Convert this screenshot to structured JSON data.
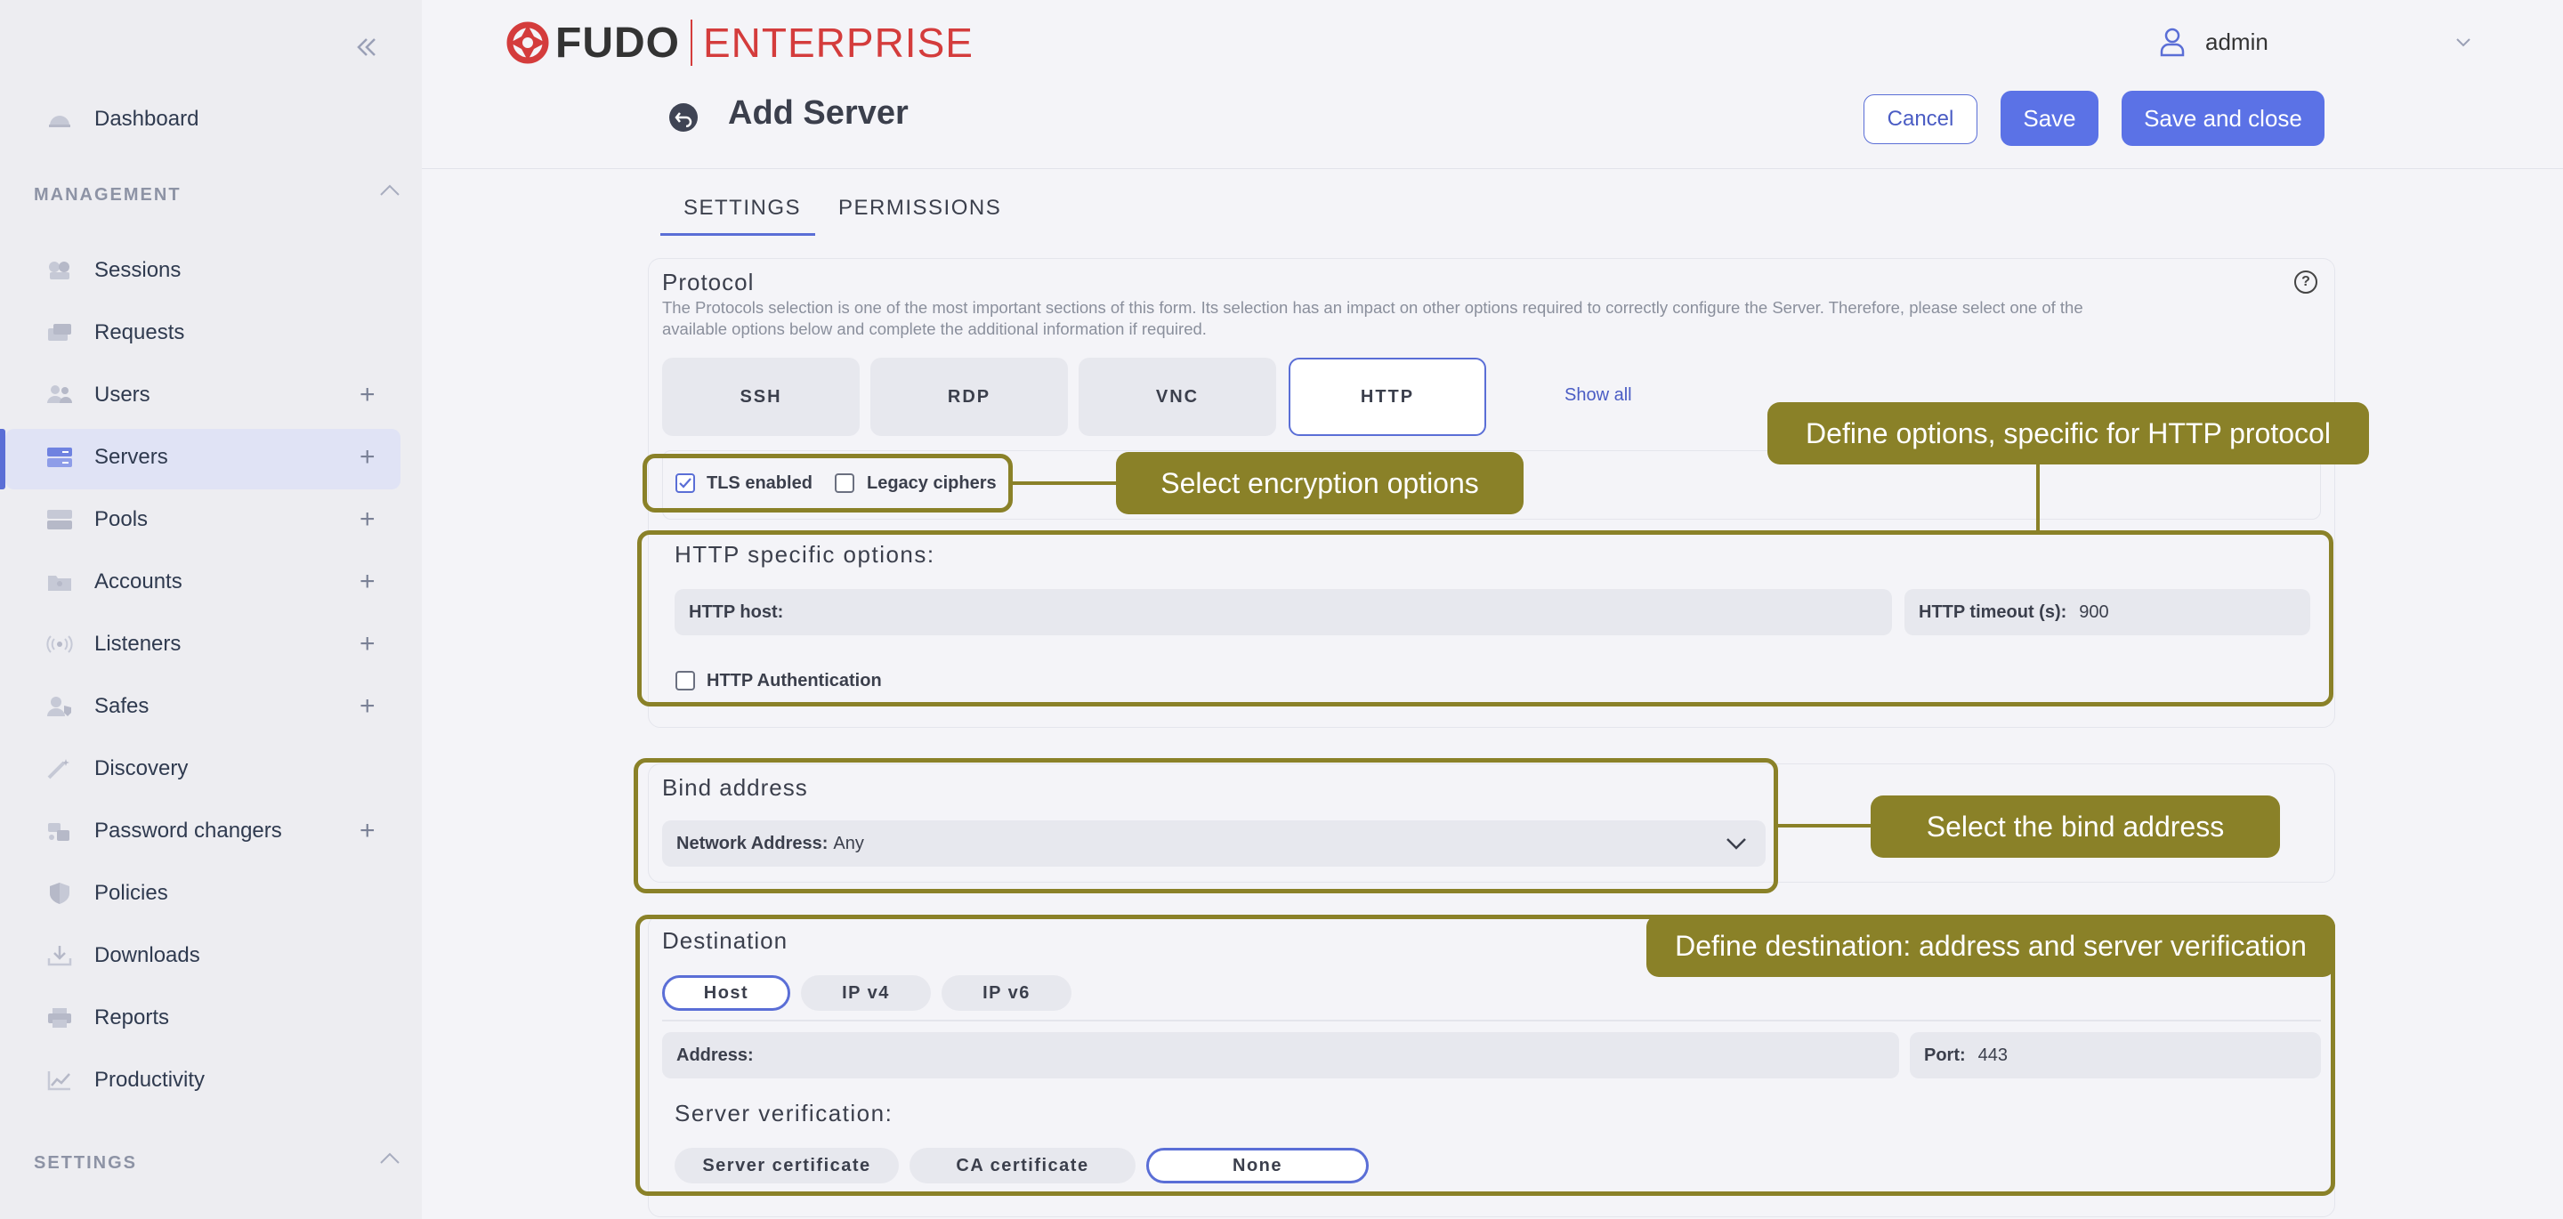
{
  "sidebar": {
    "collapse_icon": "double-chevron-left-icon",
    "dashboard": "Dashboard",
    "management_section": "MANAGEMENT",
    "items": [
      {
        "label": "Sessions",
        "icon": "sessions-icon",
        "plus": ""
      },
      {
        "label": "Requests",
        "icon": "requests-icon",
        "plus": ""
      },
      {
        "label": "Users",
        "icon": "users-icon",
        "plus": "+"
      },
      {
        "label": "Servers",
        "icon": "servers-icon",
        "plus": "+"
      },
      {
        "label": "Pools",
        "icon": "pools-icon",
        "plus": "+"
      },
      {
        "label": "Accounts",
        "icon": "accounts-icon",
        "plus": "+"
      },
      {
        "label": "Listeners",
        "icon": "listeners-icon",
        "plus": "+"
      },
      {
        "label": "Safes",
        "icon": "safes-icon",
        "plus": "+"
      },
      {
        "label": "Discovery",
        "icon": "discovery-icon",
        "plus": ""
      },
      {
        "label": "Password changers",
        "icon": "password-changers-icon",
        "plus": "+"
      },
      {
        "label": "Policies",
        "icon": "policies-icon",
        "plus": ""
      },
      {
        "label": "Downloads",
        "icon": "downloads-icon",
        "plus": ""
      },
      {
        "label": "Reports",
        "icon": "reports-icon",
        "plus": ""
      },
      {
        "label": "Productivity",
        "icon": "productivity-icon",
        "plus": ""
      }
    ],
    "settings_section": "SETTINGS",
    "active_item": "Servers"
  },
  "header": {
    "logo_fudo": "FUDO",
    "logo_enterprise": "ENTERPRISE",
    "username": "admin",
    "page_title": "Add Server",
    "cancel_label": "Cancel",
    "save_label": "Save",
    "save_close_label": "Save and close"
  },
  "tabs": [
    {
      "label": "SETTINGS",
      "active": true
    },
    {
      "label": "PERMISSIONS",
      "active": false
    }
  ],
  "protocol": {
    "title": "Protocol",
    "description_line1": "The Protocols selection is one of the most important sections of this form. Its selection has an impact on other options required to correctly configure the Server. Therefore, please select one of the",
    "description_line2": "available options below and complete the additional information if required.",
    "options": [
      "SSH",
      "RDP",
      "VNC",
      "HTTP"
    ],
    "selected": "HTTP",
    "show_all": "Show all",
    "help_icon": "?",
    "tls_enabled_label": "TLS enabled",
    "tls_enabled": true,
    "legacy_ciphers_label": "Legacy ciphers",
    "legacy_ciphers": false
  },
  "http_options": {
    "title": "HTTP specific options:",
    "host_label": "HTTP host:",
    "host_value": "",
    "timeout_label": "HTTP timeout (s):",
    "timeout_value": "900",
    "auth_label": "HTTP Authentication",
    "auth_checked": false
  },
  "bind": {
    "title": "Bind address",
    "label": "Network Address:",
    "value": "Any"
  },
  "destination": {
    "title": "Destination",
    "address_types": [
      "Host",
      "IP v4",
      "IP v6"
    ],
    "selected_type": "Host",
    "address_label": "Address:",
    "address_value": "",
    "port_label": "Port:",
    "port_value": "443",
    "verification_title": "Server verification:",
    "verification_options": [
      "Server certificate",
      "CA certificate",
      "None"
    ],
    "selected_verification": "None"
  },
  "annotations": {
    "encryption": "Select encryption options",
    "http_options": "Define options, specific for HTTP protocol",
    "bind": "Select the bind address",
    "destination": "Define destination: address and server verification"
  },
  "colors": {
    "accent": "#5b72e6",
    "brand_red": "#d43c3c",
    "annotation": "#8a8128"
  }
}
